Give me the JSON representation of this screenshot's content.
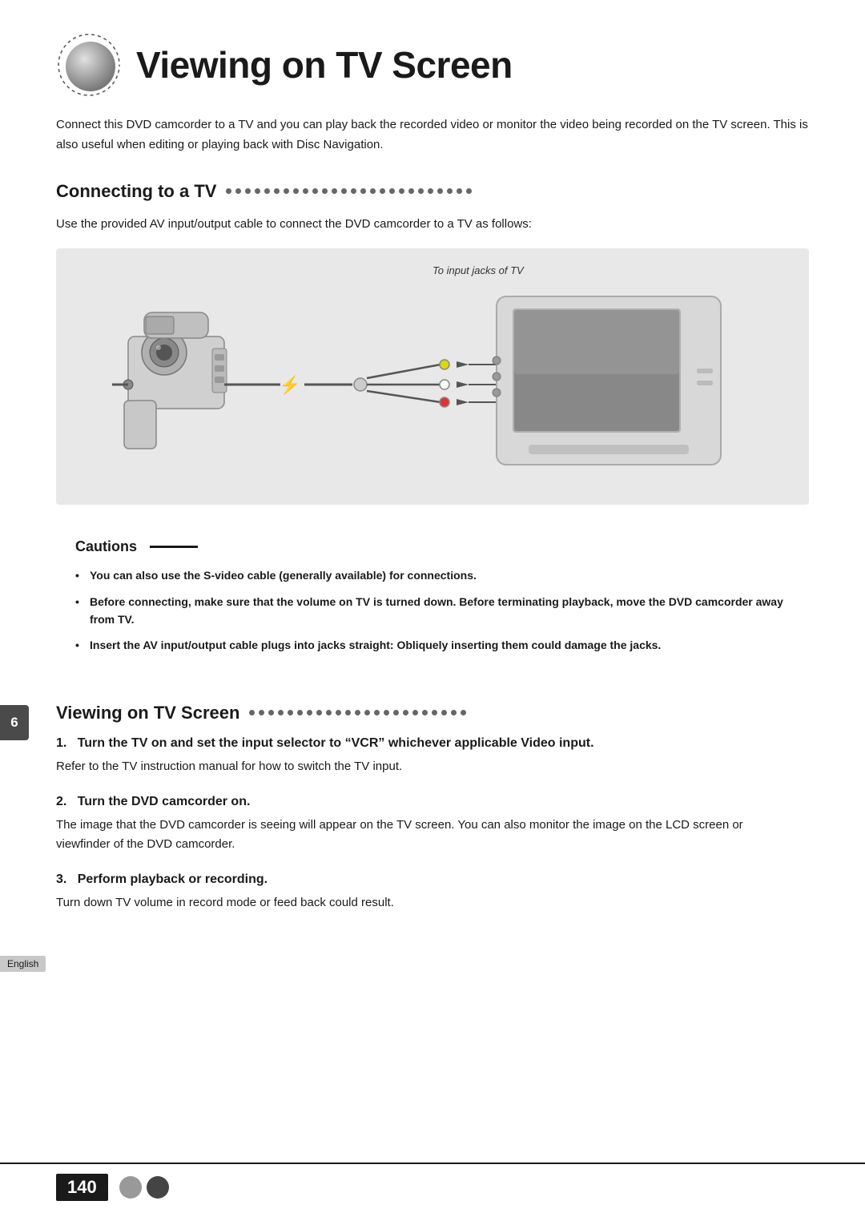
{
  "page": {
    "title": "Viewing on TV Screen",
    "intro": "Connect this DVD camcorder to a TV and you can play back the recorded video or monitor the video being recorded on the TV screen. This is also useful when editing or playing back with Disc Navigation.",
    "page_number": "140",
    "page_badge_number": "6",
    "english_label": "English"
  },
  "section1": {
    "heading": "Connecting to a TV",
    "body": "Use the provided AV input/output cable to connect the DVD camcorder to a TV as follows:",
    "diagram_label": "To input jacks of TV"
  },
  "cautions": {
    "title": "Cautions",
    "items": [
      "You can also use the S-video cable (generally available) for connections.",
      "Before connecting, make sure that the volume on TV is turned down. Before terminating playback, move the DVD camcorder away from TV.",
      "Insert the AV input/output cable plugs into jacks straight: Obliquely inserting them could damage the jacks."
    ]
  },
  "section2": {
    "heading": "Viewing on TV Screen",
    "steps": [
      {
        "number": "1.",
        "heading": "Turn the TV on and set the input selector to “VCR” whichever applicable Video input.",
        "body": "Refer to the TV instruction manual for how to switch the TV input."
      },
      {
        "number": "2.",
        "heading": "Turn the DVD camcorder on.",
        "body": "The image that the DVD camcorder is seeing will appear on the TV screen. You can also monitor the image on the LCD screen or viewfinder of the DVD camcorder."
      },
      {
        "number": "3.",
        "heading": "Perform playback or recording.",
        "body": "Turn down TV volume in record mode or feed back could result."
      }
    ]
  }
}
